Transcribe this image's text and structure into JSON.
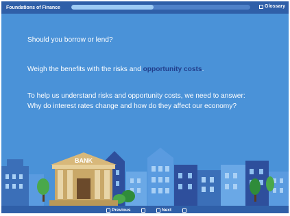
{
  "header": {
    "course_title": "Foundations of Finance",
    "glossary_label": "Glossary",
    "progress": 0.46
  },
  "content": {
    "question": "Should you borrow or lend?",
    "line2_prefix": "Weigh the benefits with the risks and ",
    "line2_highlight": "opportunity costs",
    "line2_suffix": ".",
    "line3_a": "To help us understand risks and opportunity costs, we need to answer:",
    "line3_b": "Why do interest rates change and how do they affect our economy?"
  },
  "illustration": {
    "bank_sign": "BANK"
  },
  "footer": {
    "previous_label": "Previous",
    "next_label": "Next"
  },
  "colors": {
    "background": "#4a92d8",
    "bar": "#2f5fa8",
    "accent": "#223f8c"
  }
}
